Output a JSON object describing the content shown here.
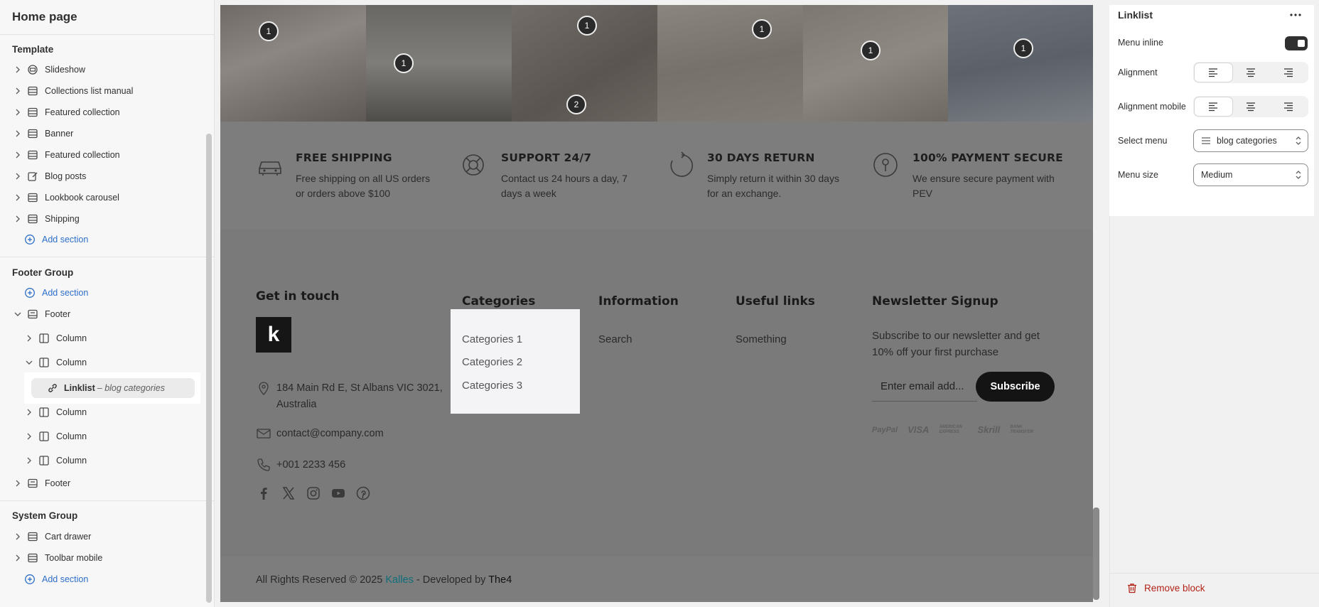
{
  "sidebar": {
    "title": "Home page",
    "template_group": "Template",
    "template_items": [
      "Slideshow",
      "Collections list manual",
      "Featured collection",
      "Banner",
      "Featured collection",
      "Blog posts",
      "Lookbook carousel",
      "Shipping"
    ],
    "add_section": "Add section",
    "footer_group": "Footer Group",
    "footer_items": {
      "footer": "Footer",
      "column": "Column",
      "linklist_label": "Linklist",
      "linklist_detail": "– blog categories",
      "footer2": "Footer"
    },
    "system_group": "System Group",
    "system_items": [
      "Cart drawer",
      "Toolbar mobile"
    ]
  },
  "preview": {
    "hotspots": [
      "1",
      "1",
      "1",
      "2",
      "1",
      "1",
      "1"
    ],
    "features": [
      {
        "title": "FREE SHIPPING",
        "desc": "Free shipping on all US orders or orders above $100",
        "icon": "car-icon"
      },
      {
        "title": "SUPPORT 24/7",
        "desc": "Contact us 24 hours a day, 7 days a week",
        "icon": "lifebuoy-icon"
      },
      {
        "title": "30 DAYS RETURN",
        "desc": "Simply return it within 30 days for an exchange.",
        "icon": "return-icon"
      },
      {
        "title": "100% PAYMENT SECURE",
        "desc": "We ensure secure payment with PEV",
        "icon": "keyhole-icon"
      }
    ],
    "footer": {
      "get_in_touch": "Get in touch",
      "logo_letter": "k",
      "address": "184 Main Rd E, St Albans VIC 3021, Australia",
      "email": "contact@company.com",
      "phone": "+001 2233 456",
      "categories_title": "Categories",
      "categories": [
        "Categories 1",
        "Categories 2",
        "Categories 3"
      ],
      "information_title": "Information",
      "information_link": "Search",
      "useful_title": "Useful links",
      "useful_link": "Something",
      "newsletter_title": "Newsletter Signup",
      "newsletter_text": "Subscribe to our newsletter and get 10% off your first purchase",
      "email_placeholder": "Enter email add...",
      "subscribe": "Subscribe",
      "payments": [
        "PayPal",
        "VISA",
        "AMERICAN EXPRESS",
        "Skrill",
        "BANK TRANSFER"
      ]
    },
    "copyright": {
      "prefix": "All Rights Reserved © 2025",
      "brand": "Kalles",
      "middle": "- Developed by",
      "dev": "The4"
    }
  },
  "panel": {
    "title": "Linklist",
    "menu_inline": "Menu inline",
    "alignment": "Alignment",
    "alignment_mobile": "Alignment mobile",
    "select_menu": "Select menu",
    "select_menu_value": "blog categories",
    "menu_size": "Menu size",
    "menu_size_value": "Medium",
    "remove": "Remove block"
  },
  "colors": {
    "accent_link": "#2c6ecb",
    "danger": "#b42318",
    "brand": "#0f6e7a"
  }
}
